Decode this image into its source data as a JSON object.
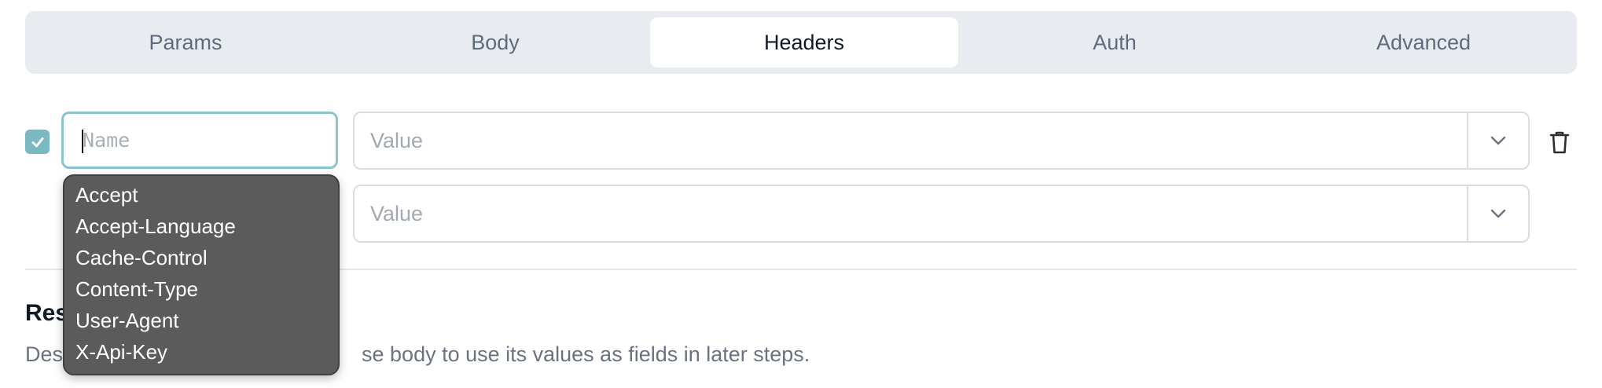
{
  "tabs": [
    {
      "label": "Params",
      "active": false
    },
    {
      "label": "Body",
      "active": false
    },
    {
      "label": "Headers",
      "active": true
    },
    {
      "label": "Auth",
      "active": false
    },
    {
      "label": "Advanced",
      "active": false
    }
  ],
  "header_rows": [
    {
      "enabled": true,
      "name_placeholder": "Name",
      "name_value": "",
      "value_placeholder": "Value",
      "value": ""
    },
    {
      "value_placeholder": "Value",
      "value": ""
    }
  ],
  "name_suggestions": [
    "Accept",
    "Accept-Language",
    "Cache-Control",
    "Content-Type",
    "User-Agent",
    "X-Api-Key"
  ],
  "response_section": {
    "title_visible": "Res",
    "description_prefix": "Des",
    "description_visible": "se body to use its values as fields in later steps."
  },
  "colors": {
    "accent": "#7ab8c2",
    "tabbar_bg": "#e8ecf0",
    "dropdown_bg": "#5b5b5b"
  },
  "icons": {
    "checkbox": "check-icon",
    "dropdown": "chevron-down-icon",
    "delete": "trash-icon"
  }
}
